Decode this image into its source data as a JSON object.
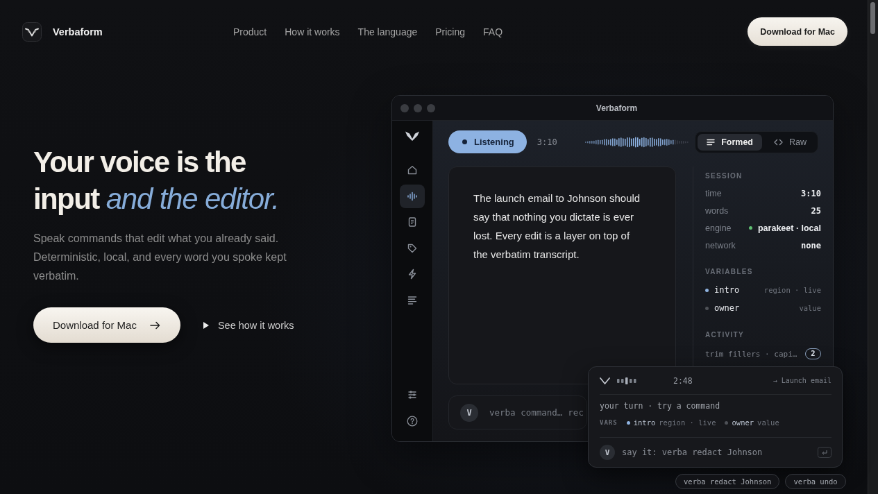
{
  "nav": {
    "brand": "Verbaform",
    "links": [
      "Product",
      "How it works",
      "The language",
      "Pricing",
      "FAQ"
    ],
    "cta": "Download for Mac"
  },
  "hero": {
    "headline": "Your voice is the input *and the editor.*",
    "lead": "Speak commands that edit what you already said. Deterministic, local, and every word you spoke kept verbatim.",
    "primary_button": "Download for Mac",
    "secondary_link": "See how it works"
  },
  "app": {
    "title": "Verbaform",
    "sidebar": {
      "items": [
        {
          "selected": false
        },
        {
          "selected": true
        },
        {
          "selected": false
        },
        {
          "selected": false
        },
        {
          "selected": false
        },
        {
          "selected": false
        }
      ]
    },
    "status": {
      "label": "Listening"
    },
    "elapsed": "3:10",
    "view_tabs": [
      {
        "label": "Formed",
        "selected": true
      },
      {
        "label": "Raw",
        "selected": false
      }
    ],
    "document": "The launch email to Johnson should say that nothing you dictate is ever lost. Every edit is a layer on top of the verbatim transcript.",
    "command_bar": {
      "avatar": "V",
      "placeholder": "verba command…",
      "suggestion": "rec"
    },
    "session": {
      "title": "SESSION",
      "rows": [
        {
          "kind": "value",
          "label": "time",
          "value": "3:10"
        },
        {
          "kind": "value",
          "label": "words",
          "value": "25"
        },
        {
          "kind": "status",
          "label": "engine",
          "value": "parakeet · local",
          "color": "#5fbf72"
        },
        {
          "kind": "value",
          "label": "network",
          "value": "none"
        }
      ]
    },
    "variables": {
      "title": "VARIABLES",
      "items": [
        {
          "name": "intro",
          "detail": "region · live",
          "color": "#8fb3e0"
        },
        {
          "name": "owner",
          "detail": "value",
          "color": "#4e5157"
        }
      ]
    },
    "activity": {
      "title": "ACTIVITY",
      "text": "trim fillers · capi…",
      "count": "2"
    }
  },
  "assistant": {
    "time": "2:48",
    "link": "→ Launch email",
    "status": "your turn · try a command",
    "vars_label": "VARS",
    "vars": [
      {
        "name": "intro",
        "detail": "region · live",
        "color": "#8fb3e0"
      },
      {
        "name": "owner",
        "detail": "value",
        "color": "#4e5157"
      }
    ],
    "avatar": "V",
    "placeholder": "say it: verba redact Johnson"
  },
  "suggestions": [
    "verba redact Johnson",
    "verba undo"
  ]
}
